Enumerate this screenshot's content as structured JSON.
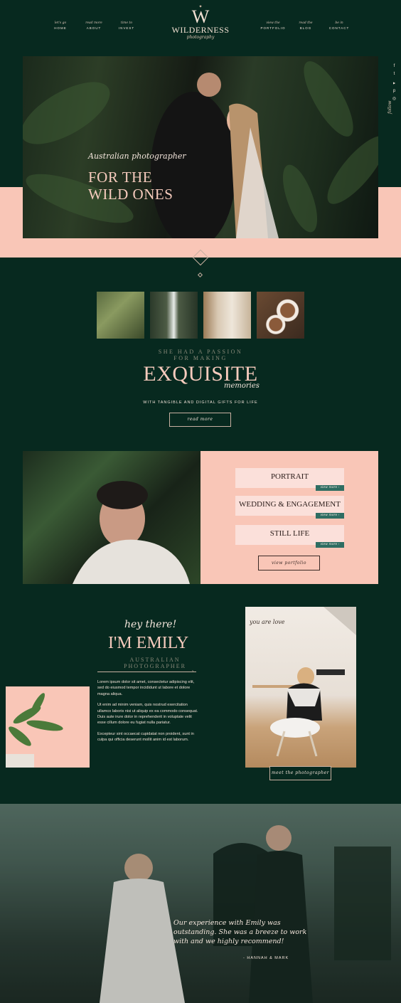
{
  "nav": {
    "left": [
      {
        "small": "let's go",
        "label": "HOME"
      },
      {
        "small": "read more",
        "label": "ABOUT"
      },
      {
        "small": "time to",
        "label": "INVEST"
      }
    ],
    "right": [
      {
        "small": "view the",
        "label": "PORTFOLIO"
      },
      {
        "small": "read the",
        "label": "BLOG"
      },
      {
        "small": "be in",
        "label": "CONTACT"
      }
    ],
    "logo": {
      "mark": "W",
      "name": "WILDERNESS",
      "sub": "photography"
    }
  },
  "social": {
    "icons": [
      "f",
      "t",
      "▶",
      "p",
      "◎"
    ],
    "follow": "follow"
  },
  "hero": {
    "script": "Australian photographer",
    "line1": "FOR THE",
    "line2": "WILD ONES"
  },
  "intro": {
    "line1": "SHE HAD A PASSION",
    "line2": "FOR MAKING",
    "headline": "EXQUISITE",
    "script": "memories",
    "sub": "WITH TANGIBLE AND DIGITAL GIFTS FOR LIFE",
    "button": "read more"
  },
  "portfolio": {
    "items": [
      {
        "label": "PORTRAIT",
        "tag": "view more ›"
      },
      {
        "label": "WEDDING & ENGAGEMENT",
        "tag": "view more ›"
      },
      {
        "label": "STILL LIFE",
        "tag": "view more ›"
      }
    ],
    "button": "view portfolio"
  },
  "about": {
    "script": "hey there!",
    "name": "I'M EMILY",
    "sub1": "AUSTRALIAN",
    "sub2": "PHOTOGRAPHER",
    "p1": "Lorem ipsum dolor sit amet, consectetur adipiscing elit, sed do eiusmod tempor incididunt ut labore et dolore magna aliqua.",
    "p2": "Ut enim ad minim veniam, quis nostrud exercitation ullamco laboris nisi ut aliquip ex ea commodo consequat. Duis aute irure dolor in reprehenderit in voluptate velit esse cillum dolore eu fugiat nulla pariatur.",
    "p3": "Excepteur sint occaecat cupidatat non proident, sunt in culpa qui officia deserunt mollit anim id est laborum.",
    "button": "meet the photographer",
    "wall": "you are love"
  },
  "testimonial": {
    "quote": "Our experience with Emily was outstanding. She was a breeze to work with and we highly recommend!",
    "author": "- HANNAH & MARK"
  }
}
